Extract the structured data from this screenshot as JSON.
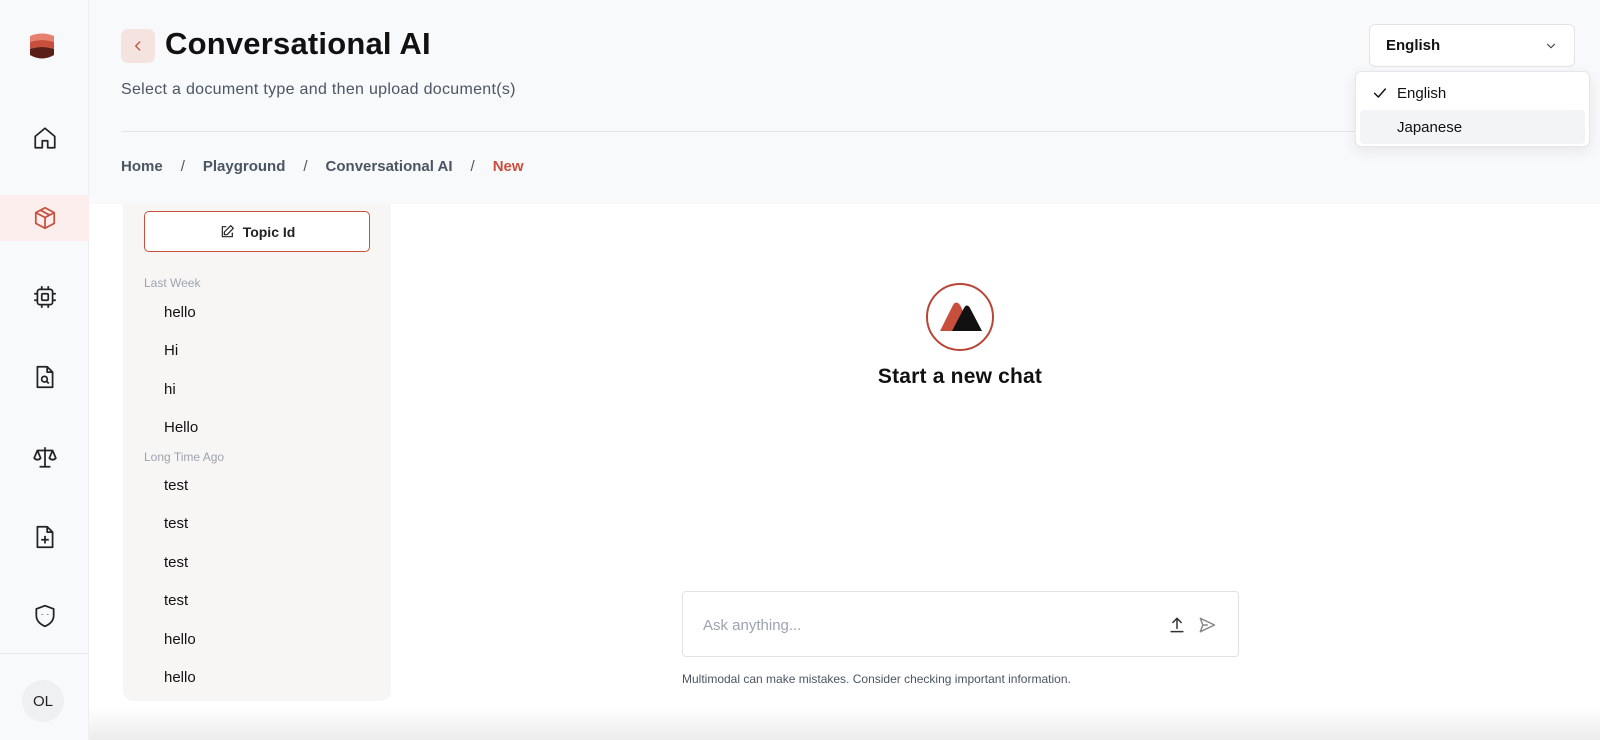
{
  "colors": {
    "accent": "#c94f3d",
    "rail_bg": "#f8f9fb",
    "active_bg": "#fbeeec",
    "panel_bg": "#f8f6f5"
  },
  "rail": {
    "items": [
      {
        "icon": "home-icon",
        "active": false
      },
      {
        "icon": "cube-icon",
        "active": true
      },
      {
        "icon": "cpu-chip-icon",
        "active": false
      },
      {
        "icon": "document-search-icon",
        "active": false
      },
      {
        "icon": "scales-icon",
        "active": false
      },
      {
        "icon": "document-add-icon",
        "active": false
      },
      {
        "icon": "shield-icon",
        "active": false
      }
    ],
    "avatar_initials": "OL"
  },
  "header": {
    "title": "Conversational AI",
    "subtitle": "Select a document type and then upload document(s)",
    "breadcrumb": [
      "Home",
      "Playground",
      "Conversational AI",
      "New"
    ],
    "breadcrumb_separator": "/"
  },
  "language": {
    "selected": "English",
    "options": [
      "English",
      "Japanese"
    ]
  },
  "topics": {
    "button_label": "Topic Id",
    "sections": [
      {
        "label": "Last Week",
        "items": [
          "hello",
          "Hi",
          "hi",
          "Hello"
        ]
      },
      {
        "label": "Long Time Ago",
        "items": [
          "test",
          "test",
          "test",
          "test",
          "hello",
          "hello"
        ]
      }
    ]
  },
  "main": {
    "empty_title": "Start a new chat",
    "input_placeholder": "Ask anything...",
    "disclaimer": "Multimodal can make mistakes. Consider checking important information."
  }
}
